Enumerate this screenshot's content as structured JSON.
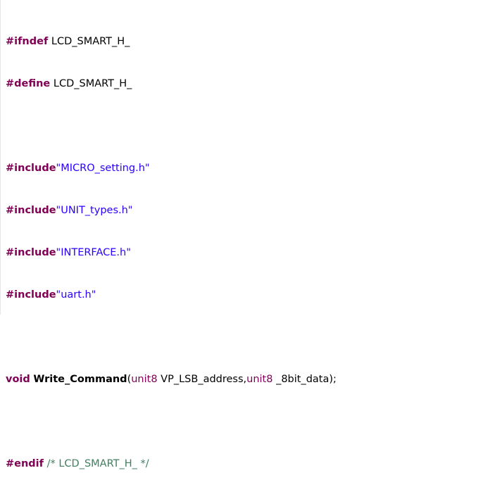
{
  "editor": {
    "lines": [
      {
        "directive": "#ifndef",
        "rest": " LCD_SMART_H_"
      },
      {
        "directive": "#define",
        "rest": " LCD_SMART_H_"
      },
      {},
      {
        "directive": "#include",
        "string": "\"MICRO_setting.h\""
      },
      {
        "directive": "#include",
        "string": "\"UNIT_types.h\""
      },
      {
        "directive": "#include",
        "string": "\"INTERFACE.h\""
      },
      {
        "directive": "#include",
        "string": "\"uart.h\""
      },
      {},
      {
        "return_type": "void",
        "function_name": "Write_Command",
        "open_paren": "(",
        "param1_type": "unit8",
        "param1_name": " VP_LSB_address,",
        "param2_type": "unit8",
        "param2_name": " _8bit_data);"
      },
      {},
      {
        "directive": "#endif",
        "comment": " /* LCD_SMART_H_ */"
      }
    ]
  }
}
